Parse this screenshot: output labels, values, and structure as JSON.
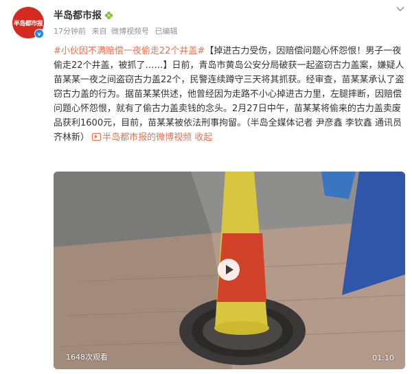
{
  "post": {
    "avatar_text": "半岛都市报",
    "username": "半岛都市报",
    "meta": {
      "time": "17分钟前",
      "source_prefix": "来自",
      "source": "微博视频号",
      "edited": "已编辑"
    },
    "text": {
      "hashtag": "#小伙因不满赔偿一夜偷走22个井盖#",
      "body": "【掉进古力受伤，因赔偿问题心怀怨恨！男子一夜偷走22个井盖，被抓了……】日前，青岛市黄岛公安分局破获一起盗窃古力盖案，嫌疑人苗某某一夜之间盗窃古力盖22个，民警连续蹲守三天将其抓获。经审查，苗某某承认了盗窃古力盖的行为。据苗某某供述，他曾经因为走路不小心掉进古力里，左腿摔断，因赔偿问题心怀怨恨，就有了偷古力盖卖钱的念头。2月27日中午，苗某某将偷来的古力盖卖废品获利1600元，目前，苗某某被依法刑事拘留。（半岛全媒体记者 尹彦鑫  李钦鑫 通讯员 齐林新）",
      "video_link": "半岛都市报的微博视频",
      "collapse": "收起"
    },
    "video": {
      "views": "1648次观看",
      "duration": "01:10"
    }
  },
  "icons": [
    "verified-icon",
    "flower-icon",
    "chevron-down-icon",
    "play-icon",
    "video-link-icon"
  ],
  "colors": {
    "accent": "#eb7350",
    "avatar_red": "#d62a1e",
    "verified_blue": "#1e88e5",
    "meta_gray": "#939393"
  }
}
